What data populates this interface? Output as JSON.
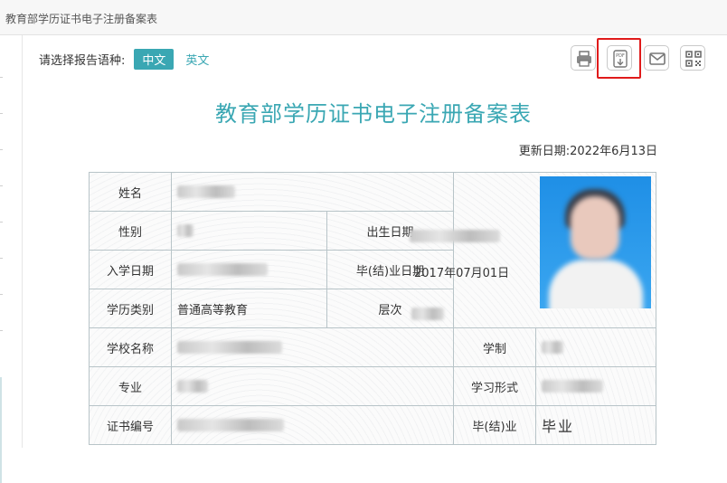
{
  "window": {
    "title": "教育部学历证书电子注册备案表"
  },
  "language": {
    "label": "请选择报告语种:",
    "options": [
      "中文",
      "英文"
    ],
    "selected": "中文"
  },
  "toolbar": {
    "icons": [
      "print-icon",
      "pdf-download-icon",
      "email-icon",
      "qrcode-icon"
    ],
    "accent": "#3aa7b3",
    "highlight_color": "#e01b1b"
  },
  "document": {
    "title": "教育部学历证书电子注册备案表",
    "update_date": "更新日期:2022年6月13日"
  },
  "record": {
    "name_label": "姓名",
    "gender_label": "性别",
    "birth_label": "出生日期",
    "enroll_label": "入学日期",
    "graduate_label": "毕(结)业日期",
    "graduate_value": "2017年07月01日",
    "category_label": "学历类别",
    "category_value": "普通高等教育",
    "level_label": "层次",
    "school_label": "学校名称",
    "duration_label": "学制",
    "major_label": "专业",
    "study_form_label": "学习形式",
    "cert_label": "证书编号",
    "status_label": "毕(结)业",
    "status_value": "毕业"
  }
}
